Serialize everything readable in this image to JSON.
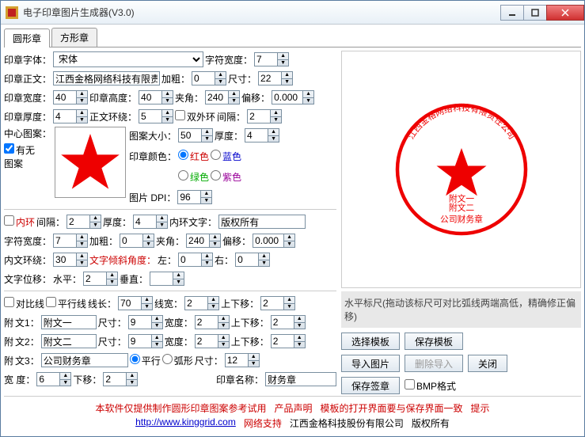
{
  "window": {
    "title": "电子印章图片生成器(V3.0)"
  },
  "tabs": {
    "round": "圆形章",
    "square": "方形章"
  },
  "labels": {
    "sealFont": "印章字体：",
    "charWidth": "字符宽度：",
    "sealText": "印章正文：",
    "bold": "加粗：",
    "size": "尺寸：",
    "sealWidth": "印章宽度：",
    "sealHeight": "印章高度：",
    "pinchAngle": "夹角：",
    "offsetMove": "偏移：",
    "sealThick": "印章厚度：",
    "textWrap": "正文环绕：",
    "doubleRing": "双外环",
    "gap": "间隔：",
    "centerPattern": "中心图案：",
    "hasPattern": "有无\n图案",
    "patternSize": "图案大小：",
    "thickness": "厚度：",
    "sealColor": "印章颜色：",
    "red": "红色",
    "blue": "蓝色",
    "green": "绿色",
    "purple": "紫色",
    "imageDpi": "图片 DPI：",
    "innerRing": "内环",
    "innerGap": "间隔：",
    "innerThick": "厚度：",
    "innerText": "内环文字：",
    "charWidth2": "字符宽度：",
    "bold2": "加粗：",
    "pinch2": "夹角：",
    "offset2": "偏移：",
    "innerWrap": "内文环绕：",
    "tiltAngle": "文字倾斜角度：",
    "left": "左：",
    "rightL": "右：",
    "textPos": "文字位移：",
    "h": "水平：",
    "v": "垂直：",
    "cmpLine": "对比线",
    "paraLine": "平行线",
    "lineLen": "线长：",
    "lineWidth": "线宽：",
    "upDown": "上下移：",
    "attach": "附",
    "text1": "文1：",
    "text2": "文2：",
    "text3": "文3：",
    "size2": "尺寸：",
    "width2": "宽度：",
    "parallel": "平行",
    "arc": "弧形",
    "widthD": "宽    度：",
    "downMove": "下移：",
    "sealName": "印章名称：",
    "rulerHint": "水平标尺(拖动该标尺可对比弧线两端高低，精确修正偏移)",
    "selectTpl": "选择模板",
    "saveTpl": "保存模板",
    "importImg": "导入图片",
    "delImport": "删除导入",
    "close": "关闭",
    "saveSig": "保存签章",
    "bmpFmt": "BMP格式"
  },
  "values": {
    "font": "宋体",
    "charWidth": "7",
    "sealText": "江西金格网络科技有限责",
    "bold": "0",
    "size": "22",
    "sealWidth": "40",
    "sealHeight": "40",
    "pinch": "240",
    "offset": "0.000",
    "sealThick": "4",
    "textWrap": "5",
    "gap": "2",
    "patternSize": "50",
    "thickness": "4",
    "dpi": "96",
    "innerGap": "2",
    "innerThick": "4",
    "innerText": "版权所有",
    "charWidth2": "7",
    "bold2": "0",
    "pinch2": "240",
    "offset2": "0.000",
    "innerWrap": "30",
    "leftV": "0",
    "rightV": "0",
    "hV": "2",
    "vV": "",
    "lineLen": "70",
    "lineWidth": "2",
    "upDown1": "2",
    "attach1": "附文一",
    "size_a1": "9",
    "width_a1": "2",
    "upDown2": "2",
    "attach2": "附文二",
    "size_a2": "9",
    "width_a2": "2",
    "upDown3": "2",
    "attach3": "公司财务章",
    "size_a3": "12",
    "widthD": "6",
    "downMove": "2",
    "sealName": "财务章"
  },
  "preview": {
    "ringText": "江西金格网络科技有限责任公司",
    "line1": "附文一",
    "line2": "附文二",
    "line3": "公司财务章"
  },
  "footer": {
    "disclaimer": "本软件仅提供制作圆形印章图案参考试用",
    "prodDecl": "产品声明",
    "tplHint": "模板的打开界面要与保存界面一致",
    "hint": "提示",
    "url": "http://www.kinggrid.com",
    "netSupport": "网络支持",
    "company": "江西金格科技股份有限公司",
    "copyright": "版权所有"
  }
}
